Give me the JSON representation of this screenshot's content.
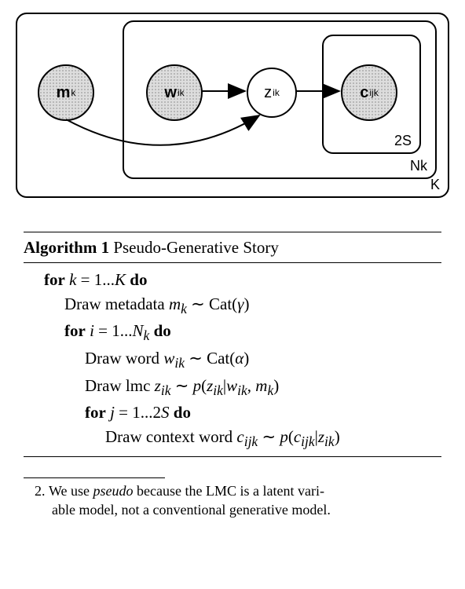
{
  "diagram": {
    "nodes": {
      "m": {
        "var": "m",
        "sub": "k"
      },
      "w": {
        "var": "w",
        "sub": "ik"
      },
      "z": {
        "var": "z",
        "sub": "ik"
      },
      "c": {
        "var": "c",
        "sub": "ijk"
      }
    },
    "plate_labels": {
      "outer": "K",
      "middle": "N",
      "middle_sub": "k",
      "inner": "2S"
    }
  },
  "algorithm": {
    "number": "Algorithm 1",
    "title": "Pseudo-Generative Story",
    "lines": {
      "for_k": "for k = 1...K do",
      "draw_m": "Draw metadata m_k ∼ Cat(γ)",
      "for_i": "for i = 1...N_k do",
      "draw_w": "Draw word w_{ik} ∼ Cat(α)",
      "draw_z": "Draw lmc z_{ik} ∼ p(z_{ik} | w_{ik}, m_k)",
      "for_j": "for j = 1...2S do",
      "draw_c": "Draw context word c_{ijk} ∼ p(c_{ijk} | z_{ik})"
    }
  },
  "footnote": {
    "num": "2.",
    "text_a": "We use ",
    "text_em": "pseudo",
    "text_b": " because the LMC is a latent vari-",
    "text_c": "able model, not a conventional generative model."
  }
}
